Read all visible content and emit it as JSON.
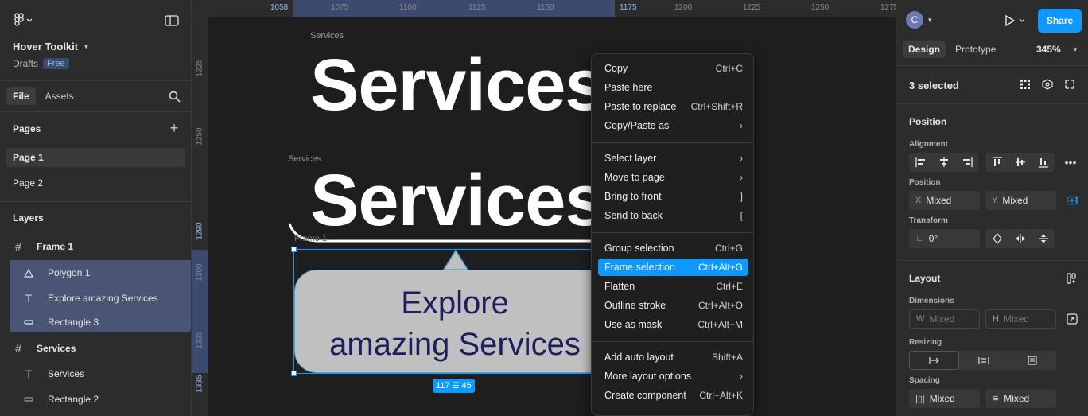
{
  "left": {
    "file_name": "Hover Toolkit",
    "drafts": "Drafts",
    "plan_badge": "Free",
    "tabs": [
      "File",
      "Assets"
    ],
    "pages_title": "Pages",
    "pages": [
      "Page 1",
      "Page 2"
    ],
    "layers_title": "Layers",
    "layers": [
      {
        "name": "Frame 1"
      },
      {
        "name": "Polygon 1"
      },
      {
        "name": "Explore amazing Services"
      },
      {
        "name": "Rectangle 3"
      },
      {
        "name": "Services"
      },
      {
        "name": "Services"
      },
      {
        "name": "Rectangle 2"
      }
    ]
  },
  "ruler": {
    "top": [
      "1058",
      "1075",
      "1100",
      "1125",
      "1150",
      "1175",
      "1200",
      "1225",
      "1250",
      "1275"
    ],
    "left": [
      "1225",
      "1250",
      "1290",
      "1300",
      "1325",
      "1335"
    ]
  },
  "canvas": {
    "frame_label_1": "Services",
    "heading_1": "Services",
    "frame_label_2": "Services",
    "heading_2": "Services",
    "frame_label_3": "Frame 1",
    "button_text_line1": "Explore",
    "button_text_line2": "amazing Services",
    "size_badge_w": "117",
    "size_badge_h": "45"
  },
  "menu": {
    "items": [
      {
        "label": "Copy",
        "shortcut": "Ctrl+C"
      },
      {
        "label": "Paste here",
        "shortcut": ""
      },
      {
        "label": "Paste to replace",
        "shortcut": "Ctrl+Shift+R"
      },
      {
        "label": "Copy/Paste as",
        "shortcut": "›"
      },
      {
        "label": "Select layer",
        "shortcut": "›"
      },
      {
        "label": "Move to page",
        "shortcut": "›"
      },
      {
        "label": "Bring to front",
        "shortcut": "]"
      },
      {
        "label": "Send to back",
        "shortcut": "["
      },
      {
        "label": "Group selection",
        "shortcut": "Ctrl+G"
      },
      {
        "label": "Frame selection",
        "shortcut": "Ctrl+Alt+G"
      },
      {
        "label": "Flatten",
        "shortcut": "Ctrl+E"
      },
      {
        "label": "Outline stroke",
        "shortcut": "Ctrl+Alt+O"
      },
      {
        "label": "Use as mask",
        "shortcut": "Ctrl+Alt+M"
      },
      {
        "label": "Add auto layout",
        "shortcut": "Shift+A"
      },
      {
        "label": "More layout options",
        "shortcut": "›"
      },
      {
        "label": "Create component",
        "shortcut": "Ctrl+Alt+K"
      }
    ],
    "highlight_color": "#0d99ff"
  },
  "right": {
    "avatar_letter": "C",
    "share_label": "Share",
    "tabs": [
      "Design",
      "Prototype"
    ],
    "zoom": "345%",
    "selection": "3 selected",
    "position_title": "Position",
    "alignment_label": "Alignment",
    "position_label": "Position",
    "x_key": "X",
    "x_value": "Mixed",
    "y_key": "Y",
    "y_value": "Mixed",
    "transform_label": "Transform",
    "rotation_value": "0°",
    "layout_title": "Layout",
    "dimensions_label": "Dimensions",
    "w_key": "W",
    "w_placeholder": "Mixed",
    "h_key": "H",
    "h_placeholder": "Mixed",
    "resizing_label": "Resizing",
    "spacing_label": "Spacing",
    "spacing_h_value": "Mixed",
    "spacing_v_value": "Mixed",
    "accent": "#0d99ff"
  }
}
